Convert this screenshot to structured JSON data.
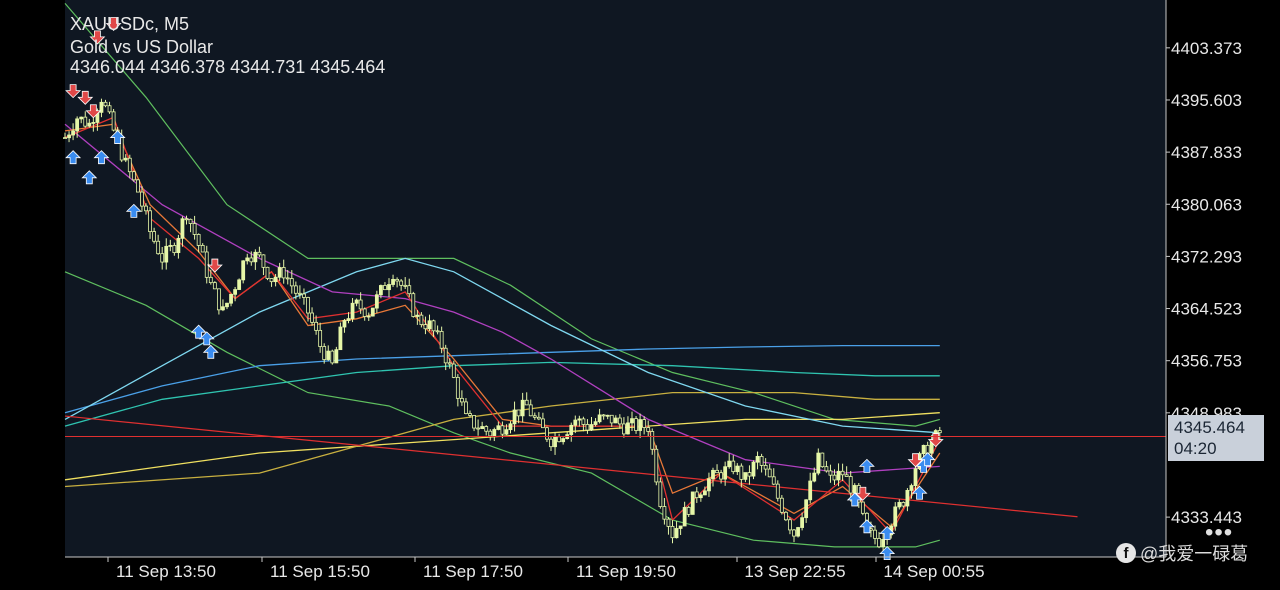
{
  "header": {
    "symbol_line": "XAUUSDc, M5",
    "description": "Gold vs US Dollar",
    "ohlc": "4346.044 4346.378 4344.731 4345.464"
  },
  "chart_data": {
    "type": "candlestick",
    "symbol": "XAUUSDc",
    "timeframe": "M5",
    "y_ticks": [
      "4403.373",
      "4395.603",
      "4387.833",
      "4380.063",
      "4372.293",
      "4364.523",
      "4356.753",
      "4348.983",
      "4333.443"
    ],
    "ylim": [
      4327.5,
      4410.5
    ],
    "x_ticks": [
      "11 Sep 13:50",
      "11 Sep 15:50",
      "11 Sep 17:50",
      "11 Sep 19:50",
      "13 Sep 22:55",
      "14 Sep 00:55"
    ],
    "current_price": "4345.464",
    "countdown": "04:20",
    "close_path": [
      [
        0,
        4390
      ],
      [
        3,
        4393
      ],
      [
        6,
        4392
      ],
      [
        9,
        4396
      ],
      [
        12,
        4391
      ],
      [
        15,
        4386
      ],
      [
        18,
        4382
      ],
      [
        21,
        4376
      ],
      [
        24,
        4372
      ],
      [
        27,
        4374
      ],
      [
        30,
        4379
      ],
      [
        33,
        4374
      ],
      [
        36,
        4368
      ],
      [
        39,
        4364
      ],
      [
        42,
        4368
      ],
      [
        45,
        4373
      ],
      [
        48,
        4372
      ],
      [
        51,
        4369
      ],
      [
        54,
        4370
      ],
      [
        57,
        4367
      ],
      [
        60,
        4364
      ],
      [
        63,
        4359
      ],
      [
        66,
        4356
      ],
      [
        69,
        4363
      ],
      [
        72,
        4365
      ],
      [
        75,
        4364
      ],
      [
        78,
        4367
      ],
      [
        81,
        4370
      ],
      [
        84,
        4367
      ],
      [
        87,
        4363
      ],
      [
        90,
        4362
      ],
      [
        93,
        4359
      ],
      [
        96,
        4354
      ],
      [
        99,
        4348
      ],
      [
        102,
        4347
      ],
      [
        105,
        4346
      ],
      [
        108,
        4347
      ],
      [
        111,
        4349
      ],
      [
        114,
        4350
      ],
      [
        117,
        4347
      ],
      [
        120,
        4345
      ],
      [
        123,
        4346
      ],
      [
        126,
        4348
      ],
      [
        129,
        4347
      ],
      [
        132,
        4348
      ],
      [
        135,
        4348
      ],
      [
        138,
        4347
      ],
      [
        141,
        4347
      ],
      [
        144,
        4347
      ],
      [
        147,
        4336
      ],
      [
        150,
        4331
      ],
      [
        153,
        4334
      ],
      [
        156,
        4337
      ],
      [
        159,
        4339
      ],
      [
        162,
        4340
      ],
      [
        165,
        4341
      ],
      [
        168,
        4339
      ],
      [
        171,
        4342
      ],
      [
        174,
        4339
      ],
      [
        177,
        4335
      ],
      [
        180,
        4331
      ],
      [
        183,
        4336
      ],
      [
        186,
        4342
      ],
      [
        189,
        4339
      ],
      [
        192,
        4340
      ],
      [
        195,
        4337
      ],
      [
        198,
        4331
      ],
      [
        201,
        4330
      ],
      [
        204,
        4333
      ],
      [
        207,
        4336
      ],
      [
        210,
        4341
      ],
      [
        213,
        4344
      ],
      [
        216,
        4346
      ]
    ],
    "moving_averages": [
      {
        "color": "#f0e060",
        "values": [
          [
            0,
            4339
          ],
          [
            24,
            4341
          ],
          [
            48,
            4343
          ],
          [
            72,
            4344
          ],
          [
            96,
            4345
          ],
          [
            120,
            4346
          ],
          [
            144,
            4347
          ],
          [
            168,
            4348
          ],
          [
            192,
            4348
          ],
          [
            216,
            4349
          ]
        ]
      },
      {
        "color": "#c8b040",
        "values": [
          [
            0,
            4338
          ],
          [
            48,
            4340
          ],
          [
            72,
            4344
          ],
          [
            96,
            4348
          ],
          [
            120,
            4350
          ],
          [
            150,
            4352
          ],
          [
            180,
            4352
          ],
          [
            200,
            4351
          ],
          [
            216,
            4351
          ]
        ]
      },
      {
        "color": "#4aa0e8",
        "values": [
          [
            0,
            4349
          ],
          [
            24,
            4353
          ],
          [
            48,
            4356
          ],
          [
            72,
            4357
          ],
          [
            96,
            4357.5
          ],
          [
            120,
            4358
          ],
          [
            144,
            4358.5
          ],
          [
            168,
            4358.8
          ],
          [
            192,
            4359
          ],
          [
            216,
            4359
          ]
        ]
      },
      {
        "color": "#2fc4b0",
        "values": [
          [
            0,
            4347
          ],
          [
            24,
            4351
          ],
          [
            48,
            4353
          ],
          [
            72,
            4355
          ],
          [
            96,
            4356
          ],
          [
            120,
            4356.5
          ],
          [
            150,
            4356
          ],
          [
            180,
            4355
          ],
          [
            200,
            4354.5
          ],
          [
            216,
            4354.5
          ]
        ]
      },
      {
        "color": "#7fd8f0",
        "values": [
          [
            0,
            4348
          ],
          [
            24,
            4356
          ],
          [
            48,
            4364
          ],
          [
            72,
            4370
          ],
          [
            84,
            4372
          ],
          [
            96,
            4370
          ],
          [
            108,
            4366
          ],
          [
            120,
            4362
          ],
          [
            144,
            4355
          ],
          [
            168,
            4350
          ],
          [
            192,
            4347
          ],
          [
            216,
            4346
          ]
        ]
      },
      {
        "color": "#b040c0",
        "values": [
          [
            0,
            4392
          ],
          [
            24,
            4380
          ],
          [
            48,
            4372
          ],
          [
            66,
            4367
          ],
          [
            84,
            4366
          ],
          [
            96,
            4364
          ],
          [
            108,
            4361
          ],
          [
            120,
            4357
          ],
          [
            144,
            4348
          ],
          [
            168,
            4342
          ],
          [
            192,
            4340
          ],
          [
            216,
            4341
          ]
        ]
      },
      {
        "color": "#e87838",
        "values": [
          [
            0,
            4391
          ],
          [
            12,
            4392
          ],
          [
            21,
            4380
          ],
          [
            33,
            4373
          ],
          [
            42,
            4366
          ],
          [
            51,
            4370
          ],
          [
            60,
            4362
          ],
          [
            72,
            4363
          ],
          [
            84,
            4365
          ],
          [
            96,
            4357
          ],
          [
            108,
            4348
          ],
          [
            120,
            4347
          ],
          [
            144,
            4347
          ],
          [
            150,
            4337
          ],
          [
            162,
            4340
          ],
          [
            180,
            4334
          ],
          [
            192,
            4338
          ],
          [
            204,
            4332
          ],
          [
            216,
            4343
          ]
        ]
      },
      {
        "color": "#e03030",
        "values": [
          [
            0,
            4390
          ],
          [
            12,
            4393
          ],
          [
            21,
            4378
          ],
          [
            33,
            4372
          ],
          [
            42,
            4366
          ],
          [
            51,
            4370
          ],
          [
            60,
            4363
          ],
          [
            72,
            4364
          ],
          [
            84,
            4367
          ],
          [
            96,
            4356
          ],
          [
            108,
            4347
          ],
          [
            120,
            4347
          ],
          [
            144,
            4347
          ],
          [
            150,
            4333
          ],
          [
            162,
            4340
          ],
          [
            180,
            4333
          ],
          [
            192,
            4339
          ],
          [
            204,
            4331
          ],
          [
            216,
            4345
          ]
        ]
      }
    ],
    "bands": {
      "color": "#5fbf5f",
      "upper": [
        [
          0,
          4410
        ],
        [
          20,
          4396
        ],
        [
          40,
          4380
        ],
        [
          60,
          4372
        ],
        [
          80,
          4372
        ],
        [
          96,
          4372
        ],
        [
          110,
          4368
        ],
        [
          130,
          4360
        ],
        [
          150,
          4355
        ],
        [
          170,
          4352
        ],
        [
          190,
          4348
        ],
        [
          210,
          4347
        ],
        [
          216,
          4348
        ]
      ],
      "lower": [
        [
          0,
          4370
        ],
        [
          20,
          4365
        ],
        [
          40,
          4358
        ],
        [
          60,
          4352
        ],
        [
          80,
          4350
        ],
        [
          96,
          4346
        ],
        [
          110,
          4343
        ],
        [
          130,
          4340
        ],
        [
          150,
          4333
        ],
        [
          170,
          4330
        ],
        [
          190,
          4329
        ],
        [
          210,
          4329
        ],
        [
          216,
          4330
        ]
      ]
    },
    "trend_line": {
      "color": "#e03030",
      "points": [
        [
          0,
          4348.5
        ],
        [
          250,
          4333.5
        ]
      ]
    },
    "signals": [
      {
        "type": "sell",
        "x": 2,
        "price": 4397
      },
      {
        "type": "sell",
        "x": 5,
        "price": 4396
      },
      {
        "type": "sell",
        "x": 7,
        "price": 4394
      },
      {
        "type": "sell",
        "x": 8,
        "price": 4405
      },
      {
        "type": "sell",
        "x": 12,
        "price": 4407
      },
      {
        "type": "sell",
        "x": 37,
        "price": 4371
      },
      {
        "type": "sell",
        "x": 197,
        "price": 4337
      },
      {
        "type": "sell",
        "x": 210,
        "price": 4342
      },
      {
        "type": "sell",
        "x": 215,
        "price": 4345
      },
      {
        "type": "buy",
        "x": 2,
        "price": 4387
      },
      {
        "type": "buy",
        "x": 6,
        "price": 4384
      },
      {
        "type": "buy",
        "x": 9,
        "price": 4387
      },
      {
        "type": "buy",
        "x": 13,
        "price": 4390
      },
      {
        "type": "buy",
        "x": 17,
        "price": 4379
      },
      {
        "type": "buy",
        "x": 33,
        "price": 4361
      },
      {
        "type": "buy",
        "x": 35,
        "price": 4360
      },
      {
        "type": "buy",
        "x": 36,
        "price": 4358
      },
      {
        "type": "buy",
        "x": 195,
        "price": 4336
      },
      {
        "type": "buy",
        "x": 198,
        "price": 4341
      },
      {
        "type": "buy",
        "x": 198,
        "price": 4332
      },
      {
        "type": "buy",
        "x": 203,
        "price": 4331
      },
      {
        "type": "buy",
        "x": 203,
        "price": 4328
      },
      {
        "type": "buy",
        "x": 211,
        "price": 4337
      },
      {
        "type": "buy",
        "x": 212,
        "price": 4341
      },
      {
        "type": "buy",
        "x": 213,
        "price": 4342
      }
    ],
    "colors": {
      "background": "#0f1722",
      "candle": "#e6f7a8",
      "axis_text": "#e8e8e8",
      "price_box": "#c9d0da",
      "price_line": "#e03030",
      "buy_arrow": "#3a8cf0",
      "sell_arrow": "#e04848"
    }
  },
  "watermark": {
    "icon": "f",
    "text": "@我爱一碌葛"
  },
  "more_icon": "•••"
}
